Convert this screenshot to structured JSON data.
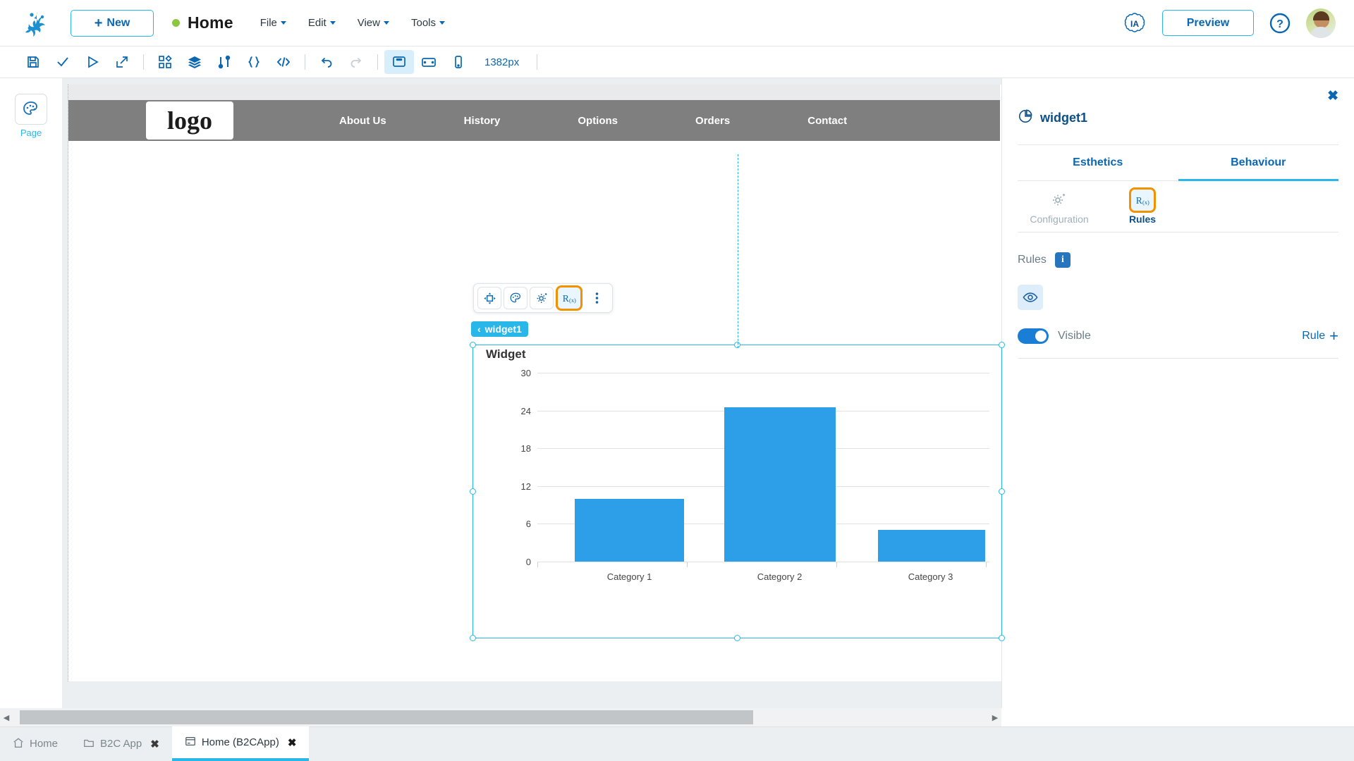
{
  "topbar": {
    "logo_icon": "frog-logo-icon",
    "new_button": {
      "label": "New",
      "icon": "plus-icon"
    },
    "status_dot": "status-dot-online",
    "page_title": "Home",
    "menus": [
      {
        "label": "File"
      },
      {
        "label": "Edit"
      },
      {
        "label": "View"
      },
      {
        "label": "Tools"
      }
    ],
    "ia_badge": "IA",
    "preview_button": "Preview",
    "help_icon": "question-mark-icon",
    "avatar": "user-avatar"
  },
  "toolbar": {
    "items": [
      {
        "name": "save-icon",
        "title": "Save"
      },
      {
        "name": "check-icon",
        "title": "Validate"
      },
      {
        "name": "play-icon",
        "title": "Run"
      },
      {
        "name": "publish-icon",
        "title": "Publish"
      },
      {
        "name": "widgets-icon",
        "title": "Widgets"
      },
      {
        "name": "layers-icon",
        "title": "Layers"
      },
      {
        "name": "dataflow-icon",
        "title": "Data flow"
      },
      {
        "name": "braces-icon",
        "title": "JSON"
      },
      {
        "name": "code-icon",
        "title": "Code"
      },
      {
        "name": "undo-icon",
        "title": "Undo"
      },
      {
        "name": "redo-icon",
        "title": "Redo"
      },
      {
        "name": "desktop-icon",
        "title": "Desktop"
      },
      {
        "name": "tablet-icon",
        "title": "Tablet"
      },
      {
        "name": "mobile-icon",
        "title": "Mobile"
      }
    ],
    "viewport_size": "1382px"
  },
  "left_rail": {
    "items": [
      {
        "label": "Page",
        "icon": "palette-icon"
      }
    ]
  },
  "canvas": {
    "site_nav": {
      "logo_text": "logo",
      "links": [
        "About Us",
        "History",
        "Options",
        "Orders",
        "Contact"
      ]
    },
    "widget_toolbar": [
      {
        "name": "move-icon",
        "highlighted": false
      },
      {
        "name": "palette-icon",
        "highlighted": false
      },
      {
        "name": "settings-icon",
        "highlighted": false
      },
      {
        "name": "rules-rx-icon",
        "highlighted": true
      },
      {
        "name": "kebab-menu-icon",
        "highlighted": false
      }
    ],
    "widget_badge": {
      "chevron": "‹",
      "label": "widget1"
    }
  },
  "chart_data": {
    "type": "bar",
    "title": "Widget",
    "categories": [
      "Category 1",
      "Category 2",
      "Category 3"
    ],
    "values": [
      10,
      24.5,
      5
    ],
    "series": [
      {
        "name": "Widget",
        "values": [
          10,
          24.5,
          5
        ]
      }
    ],
    "yticks": [
      0,
      6,
      12,
      18,
      24,
      30
    ],
    "ylim": [
      0,
      30
    ],
    "xlabel": "",
    "ylabel": "",
    "grid": true,
    "legend": "none",
    "bar_color": "#2c9fe8"
  },
  "right_panel": {
    "close_icon": "close-icon",
    "header_icon": "pie-chart-icon",
    "title": "widget1",
    "tabs": [
      {
        "label": "Esthetics",
        "active": false
      },
      {
        "label": "Behaviour",
        "active": true
      }
    ],
    "subtabs": [
      {
        "label": "Configuration",
        "icon": "settings-sparkle-icon",
        "active": false,
        "highlighted": false
      },
      {
        "label": "Rules",
        "icon": "rules-rx-icon",
        "active": true,
        "highlighted": true
      }
    ],
    "rules_section": {
      "label": "Rules",
      "info_icon": "info-icon",
      "eye_icon": "eye-icon",
      "toggle_label": "Visible",
      "toggle_on": true,
      "add_rule_label": "Rule",
      "add_rule_icon": "plus-icon"
    }
  },
  "scrollbar": {
    "left_arrow": "◀",
    "right_arrow": "▶"
  },
  "bottom_tabs": [
    {
      "label": "Home",
      "icon": "home-icon",
      "closable": false,
      "active": false
    },
    {
      "label": "B2C App",
      "icon": "folder-icon",
      "closable": true,
      "active": false
    },
    {
      "label": "Home (B2CApp)",
      "icon": "page-icon",
      "closable": true,
      "active": true
    }
  ],
  "close_glyph": "✖",
  "colors": {
    "accent_blue": "#0b67b2",
    "cyan": "#29b6e8",
    "orange_highlight": "#f39200",
    "bar_blue": "#2c9fe8",
    "nav_gray": "#7f7f7f",
    "status_green": "#8dc63f"
  }
}
